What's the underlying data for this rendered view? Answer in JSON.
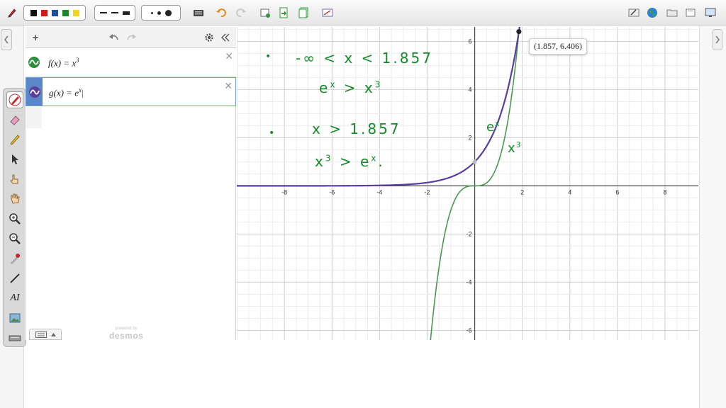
{
  "toolbar": {
    "colors": [
      "#111111",
      "#d11a1a",
      "#1b4fa0",
      "#17892c",
      "#f3d51a"
    ],
    "line_styles": [
      "dashed-thin",
      "dashed-medium",
      "solid-thick"
    ],
    "dot_sizes": [
      "small",
      "medium",
      "large"
    ],
    "icons": [
      "pen-icon",
      "keyboard-icon",
      "undo-icon",
      "redo-icon",
      "new-page-icon",
      "next-page-icon",
      "pages-icon",
      "clear-icon",
      "edit-icon",
      "globe-icon",
      "folder-icon",
      "file-icon",
      "monitor-icon",
      "menu-icon"
    ]
  },
  "tools": [
    "pen-tool-icon",
    "eraser-icon",
    "highlighter-icon",
    "pointer-icon",
    "hand-pointer-icon",
    "hand-icon",
    "zoom-in-icon",
    "zoom-out-icon",
    "color-picker-icon",
    "line-icon",
    "text-icon",
    "image-icon",
    "keyboard-icon"
  ],
  "expressions": [
    {
      "lhs": "f(x) = x",
      "sup": "3",
      "color": "#2d8f3c"
    },
    {
      "lhs": "g(x) = e",
      "sup": "x",
      "color": "#5a3ea0"
    }
  ],
  "panel": {
    "add_symbol": "+",
    "powered_by": "powered by",
    "brand": "desmos"
  },
  "graph": {
    "x_range": [
      -10,
      9.4
    ],
    "y_range": [
      -6.4,
      6.6
    ],
    "x_ticks": [
      "-8",
      "-6",
      "-4",
      "-2",
      "0",
      "2",
      "4",
      "6",
      "8"
    ],
    "y_ticks": [
      "6",
      "4",
      "2",
      "-2",
      "-4",
      "-6"
    ],
    "intersection": {
      "x": 1.857,
      "y": 6.406
    },
    "point_label": "(1.857, 6.406)",
    "curve_colors": {
      "f": "#4a9a4e",
      "g": "#5a3ea0"
    }
  },
  "annotations": {
    "line1": "-∞ < x < 1.857",
    "line2a": "e",
    "line2b": "x",
    "line2c": "> x",
    "line2d": "3",
    "line3": "x > 1.857",
    "line4a": "x",
    "line4b": "3",
    "line4c": "> e",
    "line4d": "x",
    "curve_label_e": "e",
    "curve_label_e_sup": "x",
    "curve_label_x": "x",
    "curve_label_x_sup": "3",
    "ink_color": "#168a2a"
  }
}
